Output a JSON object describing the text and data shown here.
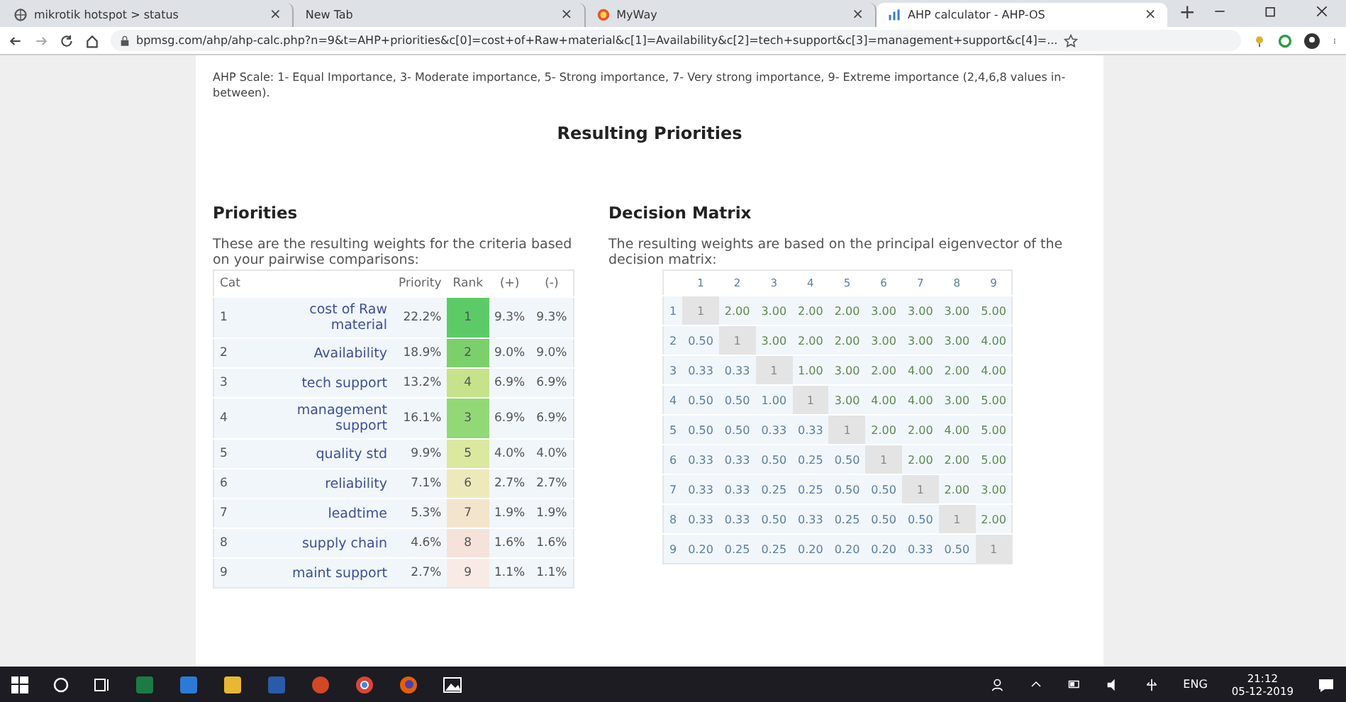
{
  "browser": {
    "tabs": [
      {
        "title": "mikrotik hotspot > status",
        "close": "×",
        "selected": false
      },
      {
        "title": "New Tab",
        "close": "×",
        "selected": false
      },
      {
        "title": "MyWay",
        "close": "×",
        "selected": false
      },
      {
        "title": "AHP calculator - AHP-OS",
        "close": "×",
        "selected": true
      }
    ],
    "new_tab": "+",
    "url": "bpmsg.com/ahp/ahp-calc.php?n=9&t=AHP+priorities&c[0]=cost+of+Raw+material&c[1]=Availability&c[2]=tech+support&c[3]=management+support&c[4]=..."
  },
  "scale_note": "AHP Scale: 1- Equal Importance, 3- Moderate importance, 5- Strong importance, 7- Very strong importance, 9- Extreme importance (2,4,6,8 values in-between).",
  "title": "Resulting Priorities",
  "priorities": {
    "heading": "Priorities",
    "intro": "These are the resulting weights for the criteria based on your pairwise comparisons:",
    "columns": [
      "Cat",
      "Priority",
      "Rank",
      "(+)",
      "(-)"
    ],
    "rows": [
      {
        "cat": "1",
        "name": "cost of Raw material",
        "priority": "22.2%",
        "rank": "1",
        "plus": "9.3%",
        "minus": "9.3%",
        "color": "#5ccb67"
      },
      {
        "cat": "2",
        "name": "Availability",
        "priority": "18.9%",
        "rank": "2",
        "plus": "9.0%",
        "minus": "9.0%",
        "color": "#7bd06c"
      },
      {
        "cat": "3",
        "name": "tech support",
        "priority": "13.2%",
        "rank": "4",
        "plus": "6.9%",
        "minus": "6.9%",
        "color": "#c6e28a"
      },
      {
        "cat": "4",
        "name": "management support",
        "priority": "16.1%",
        "rank": "3",
        "plus": "6.9%",
        "minus": "6.9%",
        "color": "#93d877"
      },
      {
        "cat": "5",
        "name": "quality std",
        "priority": "9.9%",
        "rank": "5",
        "plus": "4.0%",
        "minus": "4.0%",
        "color": "#dbe8a0"
      },
      {
        "cat": "6",
        "name": "reliability",
        "priority": "7.1%",
        "rank": "6",
        "plus": "2.7%",
        "minus": "2.7%",
        "color": "#ede9bb"
      },
      {
        "cat": "7",
        "name": "leadtime",
        "priority": "5.3%",
        "rank": "7",
        "plus": "1.9%",
        "minus": "1.9%",
        "color": "#f3e4cc"
      },
      {
        "cat": "8",
        "name": "supply chain",
        "priority": "4.6%",
        "rank": "8",
        "plus": "1.6%",
        "minus": "1.6%",
        "color": "#f5e2da"
      },
      {
        "cat": "9",
        "name": "maint support",
        "priority": "2.7%",
        "rank": "9",
        "plus": "1.1%",
        "minus": "1.1%",
        "color": "#f8ebe6"
      }
    ]
  },
  "matrix": {
    "heading": "Decision Matrix",
    "intro": "The resulting weights are based on the principal eigenvector of the decision matrix:",
    "columns": [
      "1",
      "2",
      "3",
      "4",
      "5",
      "6",
      "7",
      "8",
      "9"
    ],
    "rows": [
      {
        "label": "1",
        "cells": [
          "1",
          "2.00",
          "3.00",
          "2.00",
          "2.00",
          "3.00",
          "3.00",
          "3.00",
          "5.00"
        ]
      },
      {
        "label": "2",
        "cells": [
          "0.50",
          "1",
          "3.00",
          "2.00",
          "2.00",
          "3.00",
          "3.00",
          "3.00",
          "4.00"
        ]
      },
      {
        "label": "3",
        "cells": [
          "0.33",
          "0.33",
          "1",
          "1.00",
          "3.00",
          "2.00",
          "4.00",
          "2.00",
          "4.00"
        ]
      },
      {
        "label": "4",
        "cells": [
          "0.50",
          "0.50",
          "1.00",
          "1",
          "3.00",
          "4.00",
          "4.00",
          "3.00",
          "5.00"
        ]
      },
      {
        "label": "5",
        "cells": [
          "0.50",
          "0.50",
          "0.33",
          "0.33",
          "1",
          "2.00",
          "2.00",
          "4.00",
          "5.00"
        ]
      },
      {
        "label": "6",
        "cells": [
          "0.33",
          "0.33",
          "0.50",
          "0.25",
          "0.50",
          "1",
          "2.00",
          "2.00",
          "5.00"
        ]
      },
      {
        "label": "7",
        "cells": [
          "0.33",
          "0.33",
          "0.25",
          "0.25",
          "0.50",
          "0.50",
          "1",
          "2.00",
          "3.00"
        ]
      },
      {
        "label": "8",
        "cells": [
          "0.33",
          "0.33",
          "0.50",
          "0.33",
          "0.25",
          "0.50",
          "0.50",
          "1",
          "2.00"
        ]
      },
      {
        "label": "9",
        "cells": [
          "0.20",
          "0.25",
          "0.25",
          "0.20",
          "0.20",
          "0.20",
          "0.33",
          "0.50",
          "1"
        ]
      }
    ]
  },
  "taskbar": {
    "language": "ENG",
    "time": "21:12",
    "date": "05-12-2019"
  }
}
